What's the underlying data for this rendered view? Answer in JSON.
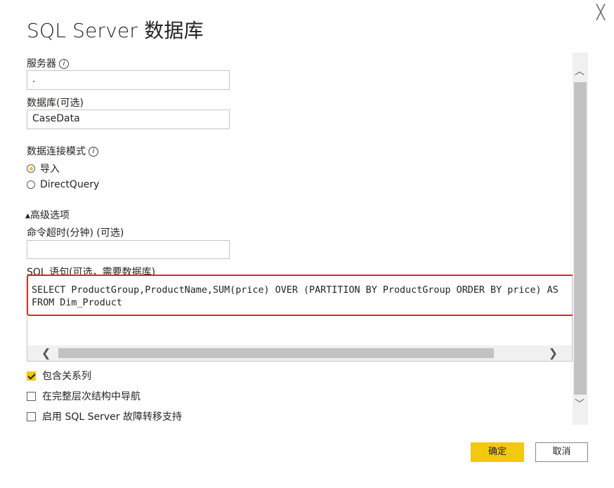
{
  "dialog": {
    "title": "SQL Server 数据库",
    "close_glyph": "╳"
  },
  "server": {
    "label": "服务器",
    "info_glyph": "i",
    "value": "."
  },
  "database": {
    "label": "数据库(可选)",
    "value": "CaseData"
  },
  "connectivity": {
    "label": "数据连接模式",
    "info_glyph": "i",
    "options": [
      {
        "label": "导入",
        "selected": true
      },
      {
        "label": "DirectQuery",
        "selected": false
      }
    ]
  },
  "advanced": {
    "toggle_label": "▴高级选项",
    "timeout_label": "命令超时(分钟) (可选)",
    "timeout_value": "",
    "sql_label": "SQL 语句(可选，需要数据库)",
    "sql_lines": [
      "SELECT ProductGroup,ProductName,SUM(price) OVER (PARTITION BY ProductGroup ORDER BY price) AS",
      "FROM Dim_Product"
    ],
    "scroll_left": "❮",
    "scroll_right": "❯"
  },
  "vertical_scroll": {
    "up": "︿",
    "down": "﹀"
  },
  "options": [
    {
      "label": "包含关系列",
      "checked": true
    },
    {
      "label": "在完整层次结构中导航",
      "checked": false
    },
    {
      "label": "启用 SQL Server 故障转移支持",
      "checked": false
    }
  ],
  "buttons": {
    "ok": "确定",
    "cancel": "取消"
  },
  "colors": {
    "accent": "#f2c811",
    "highlight": "#e6241b"
  }
}
